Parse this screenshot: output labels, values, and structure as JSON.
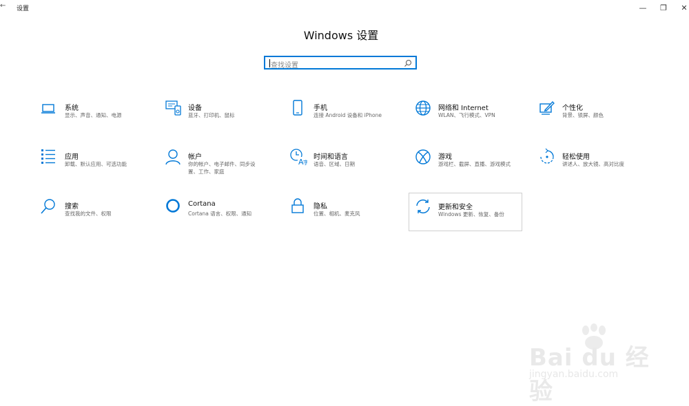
{
  "window": {
    "title": "设置",
    "min": "—",
    "max": "❐",
    "close": "✕",
    "back": "←"
  },
  "page": {
    "title": "Windows 设置"
  },
  "search": {
    "placeholder": "查找设置"
  },
  "tiles": [
    {
      "title": "系统",
      "desc": "显示、声音、通知、电源",
      "icon": "laptop-icon"
    },
    {
      "title": "设备",
      "desc": "蓝牙、打印机、鼠标",
      "icon": "devices-icon"
    },
    {
      "title": "手机",
      "desc": "连接 Android 设备和 iPhone",
      "icon": "phone-icon"
    },
    {
      "title": "网络和 Internet",
      "desc": "WLAN、飞行模式、VPN",
      "icon": "globe-icon"
    },
    {
      "title": "个性化",
      "desc": "背景、锁屏、颜色",
      "icon": "paint-icon"
    },
    {
      "title": "应用",
      "desc": "卸载、默认应用、可选功能",
      "icon": "apps-list-icon"
    },
    {
      "title": "帐户",
      "desc": "你的帐户、电子邮件、同步设置、工作、家庭",
      "icon": "person-icon"
    },
    {
      "title": "时间和语言",
      "desc": "语音、区域、日期",
      "icon": "time-language-icon"
    },
    {
      "title": "游戏",
      "desc": "游戏栏、截屏、直播、游戏模式",
      "icon": "xbox-icon"
    },
    {
      "title": "轻松使用",
      "desc": "讲述人、放大镜、高对比度",
      "icon": "ease-of-access-icon"
    },
    {
      "title": "搜索",
      "desc": "查找我的文件、权限",
      "icon": "search-icon"
    },
    {
      "title": "Cortana",
      "desc": "Cortana 语言、权限、通知",
      "icon": "cortana-icon"
    },
    {
      "title": "隐私",
      "desc": "位置、相机、麦克风",
      "icon": "lock-icon"
    },
    {
      "title": "更新和安全",
      "desc": "Windows 更新、恢复、备份",
      "icon": "sync-icon"
    }
  ],
  "watermark": {
    "brand": "Bai du 经验",
    "url": "jingyan.baidu.com"
  },
  "colors": {
    "accent": "#0078d7",
    "text": "#111111",
    "secondary": "#666666"
  }
}
